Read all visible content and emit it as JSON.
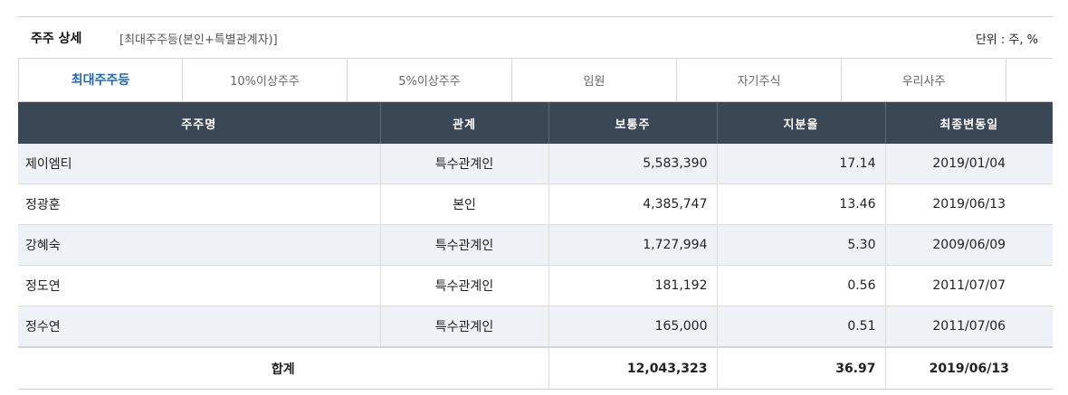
{
  "header": {
    "title": "주주 상세",
    "subtitle": "[최대주주등(본인+특별관계자)]",
    "unit": "단위 : 주, %"
  },
  "tabs": [
    {
      "label": "최대주주등",
      "active": true
    },
    {
      "label": "10%이상주주",
      "active": false
    },
    {
      "label": "5%이상주주",
      "active": false
    },
    {
      "label": "임원",
      "active": false
    },
    {
      "label": "자기주식",
      "active": false
    },
    {
      "label": "우리사주",
      "active": false
    }
  ],
  "table": {
    "columns": [
      "주주명",
      "관계",
      "보통주",
      "지분율",
      "최종변동일"
    ],
    "rows": [
      {
        "name": "제이엠티",
        "relation": "특수관계인",
        "shares": "5,583,390",
        "ratio": "17.14",
        "date": "2019/01/04"
      },
      {
        "name": "정광훈",
        "relation": "본인",
        "shares": "4,385,747",
        "ratio": "13.46",
        "date": "2019/06/13"
      },
      {
        "name": "강혜숙",
        "relation": "특수관계인",
        "shares": "1,727,994",
        "ratio": "5.30",
        "date": "2009/06/09"
      },
      {
        "name": "정도연",
        "relation": "특수관계인",
        "shares": "181,192",
        "ratio": "0.56",
        "date": "2011/07/07"
      },
      {
        "name": "정수연",
        "relation": "특수관계인",
        "shares": "165,000",
        "ratio": "0.51",
        "date": "2011/07/06"
      }
    ],
    "total": {
      "label": "합계",
      "shares": "12,043,323",
      "ratio": "36.97",
      "date": "2019/06/13"
    }
  },
  "colors": {
    "header_bg": "#3a4754",
    "active_tab": "#1e67b8",
    "row_alt": "#eef1f6"
  }
}
